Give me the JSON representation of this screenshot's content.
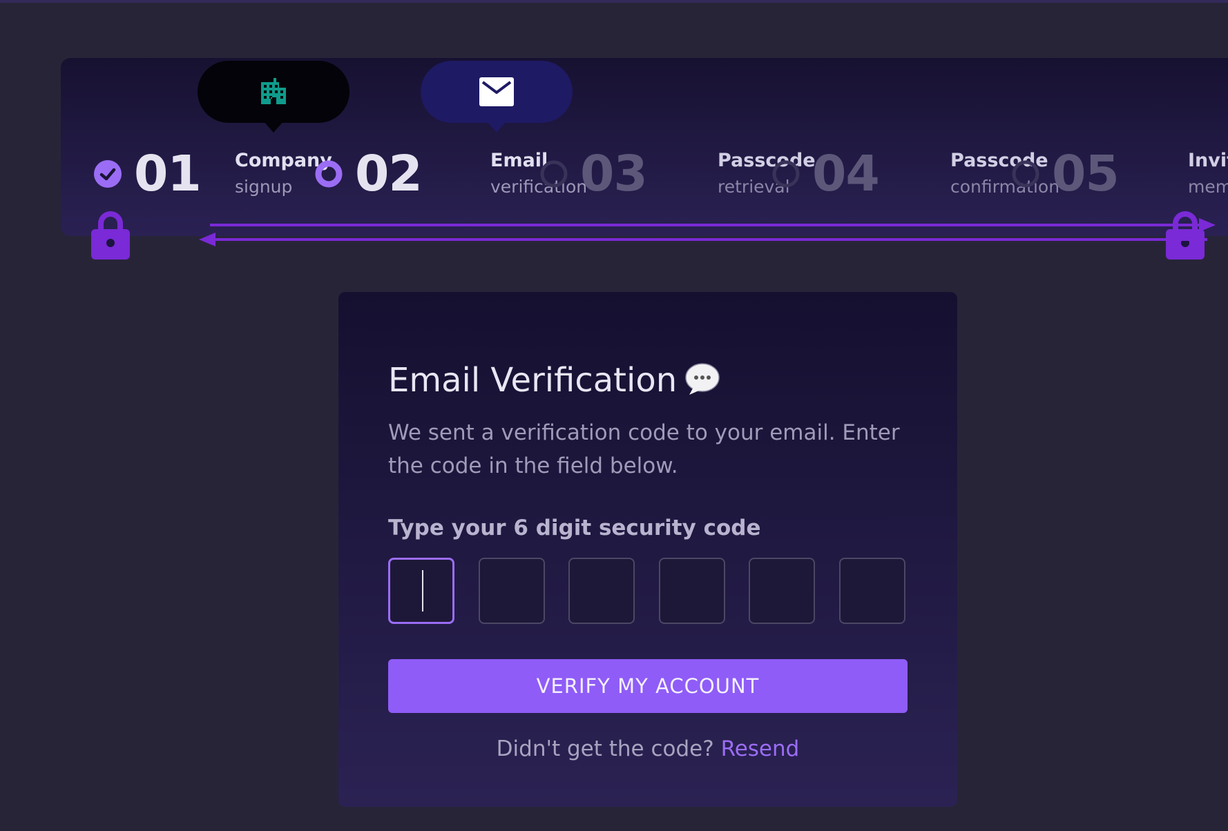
{
  "stepper": {
    "steps": [
      {
        "number": "01",
        "title": "Company",
        "subtitle": "signup",
        "status": "done"
      },
      {
        "number": "02",
        "title": "Email",
        "subtitle": "verification",
        "status": "active"
      },
      {
        "number": "03",
        "title": "Passcode",
        "subtitle": "retrieval",
        "status": "todo"
      },
      {
        "number": "04",
        "title": "Passcode",
        "subtitle": "confirmation",
        "status": "todo"
      },
      {
        "number": "05",
        "title": "Invite",
        "subtitle": "members",
        "status": "todo"
      }
    ],
    "bubbles": [
      {
        "icon": "building-icon",
        "color": "#0f9c8c"
      },
      {
        "icon": "envelope-icon",
        "color": "#ffffff"
      }
    ]
  },
  "card": {
    "title": "Email Verification",
    "title_icon": "speech-bubble-icon",
    "description": "We sent a verification code to your email. Enter the code in the field below.",
    "code_label": "Type your 6 digit security code",
    "code_length": 6,
    "verify_label": "VERIFY MY ACCOUNT",
    "resend_prompt": "Didn't get the code?",
    "resend_link": "Resend"
  },
  "colors": {
    "accent": "#8f5cf7",
    "background": "#282438",
    "lock": "#7a2ad6"
  }
}
